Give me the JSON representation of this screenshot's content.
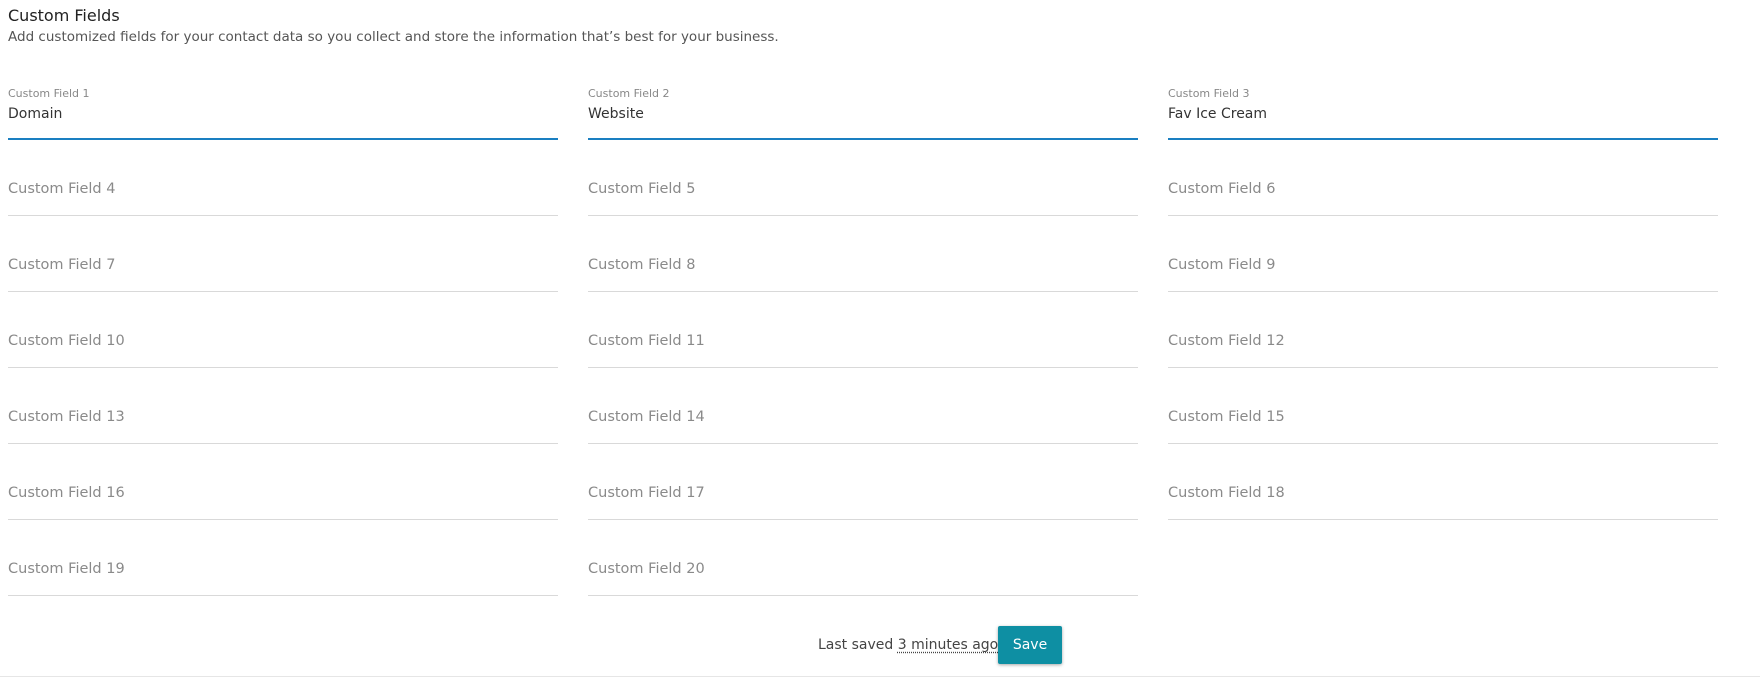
{
  "header": {
    "title": "Custom Fields",
    "subtitle": "Add customized fields for your contact data so you collect and store the information that’s best for your business."
  },
  "fields": [
    {
      "label": "Custom Field 1",
      "value": "Domain"
    },
    {
      "label": "Custom Field 2",
      "value": "Website"
    },
    {
      "label": "Custom Field 3",
      "value": "Fav Ice Cream"
    },
    {
      "label": "Custom Field 4",
      "value": ""
    },
    {
      "label": "Custom Field 5",
      "value": ""
    },
    {
      "label": "Custom Field 6",
      "value": ""
    },
    {
      "label": "Custom Field 7",
      "value": ""
    },
    {
      "label": "Custom Field 8",
      "value": ""
    },
    {
      "label": "Custom Field 9",
      "value": ""
    },
    {
      "label": "Custom Field 10",
      "value": ""
    },
    {
      "label": "Custom Field 11",
      "value": ""
    },
    {
      "label": "Custom Field 12",
      "value": ""
    },
    {
      "label": "Custom Field 13",
      "value": ""
    },
    {
      "label": "Custom Field 14",
      "value": ""
    },
    {
      "label": "Custom Field 15",
      "value": ""
    },
    {
      "label": "Custom Field 16",
      "value": ""
    },
    {
      "label": "Custom Field 17",
      "value": ""
    },
    {
      "label": "Custom Field 18",
      "value": ""
    },
    {
      "label": "Custom Field 19",
      "value": ""
    },
    {
      "label": "Custom Field 20",
      "value": ""
    }
  ],
  "footer": {
    "last_saved_prefix": "Last saved",
    "last_saved_time": "3 minutes ago",
    "save_label": "Save"
  },
  "colors": {
    "accent": "#1a7fc1",
    "save_button": "#0e8fa3"
  }
}
